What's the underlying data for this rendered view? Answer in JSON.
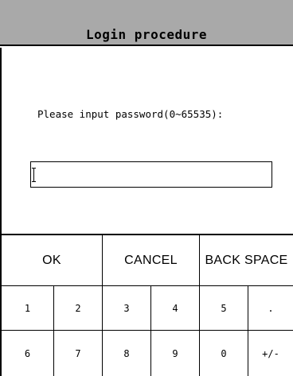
{
  "window": {
    "title": "Login procedure"
  },
  "prompt": {
    "text": "Please input password(0~65535):"
  },
  "password_field": {
    "value": ""
  },
  "keypad": {
    "ok": "OK",
    "cancel": "CANCEL",
    "back_space": "BACK SPACE",
    "digits": {
      "one": "1",
      "two": "2",
      "three": "3",
      "four": "4",
      "five": "5",
      "six": "6",
      "seven": "7",
      "eight": "8",
      "nine": "9",
      "zero": "0"
    },
    "decimal_point": ".",
    "sign_toggle": "+/-"
  },
  "colors": {
    "titlebar_background": "#a9a9a9",
    "background": "#ffffff",
    "border": "#000000",
    "text": "#000000"
  },
  "icons": {
    "text_cursor": "text-cursor-icon"
  }
}
